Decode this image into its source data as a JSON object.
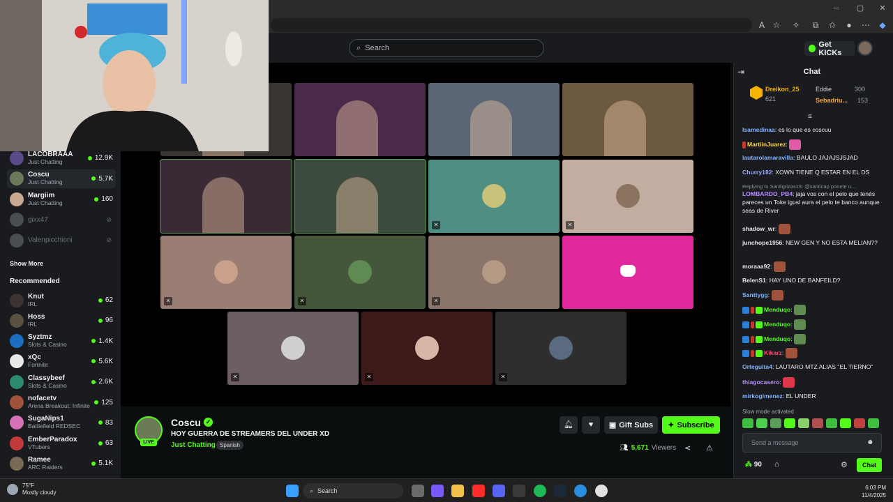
{
  "search": {
    "placeholder": "Search"
  },
  "header": {
    "get_kicks": "Get KICKs"
  },
  "sidebar": {
    "following": [
      {
        "name": "LACOBRAAA",
        "category": "Just Chatting",
        "viewers": "12.9K",
        "live": true,
        "avatar": "#5a4a8a"
      },
      {
        "name": "Coscu",
        "category": "Just Chatting",
        "viewers": "5.7K",
        "live": true,
        "avatar": "#6b7a57",
        "active": true
      },
      {
        "name": "Margiim",
        "category": "Just Chatting",
        "viewers": "160",
        "live": true,
        "avatar": "#c8a890"
      },
      {
        "name": "gixx47",
        "category": "",
        "viewers": "",
        "live": false,
        "avatar": "#4a4d52"
      },
      {
        "name": "Valenpicchioni",
        "category": "",
        "viewers": "",
        "live": false,
        "avatar": "#4a4d52"
      }
    ],
    "show_more": "Show More",
    "recommended_title": "Recommended",
    "recommended": [
      {
        "name": "Knut",
        "category": "IRL",
        "viewers": "62",
        "avatar": "#3a3330"
      },
      {
        "name": "Hoss",
        "category": "IRL",
        "viewers": "96",
        "avatar": "#5a5040"
      },
      {
        "name": "Syztmz",
        "category": "Slots & Casino",
        "viewers": "1.4K",
        "avatar": "#1b6ec2"
      },
      {
        "name": "xQc",
        "category": "Fortnite",
        "viewers": "5.6K",
        "avatar": "#e8e8e8"
      },
      {
        "name": "Classybeef",
        "category": "Slots & Casino",
        "viewers": "2.6K",
        "avatar": "#2b8a6e"
      },
      {
        "name": "nofacetv",
        "category": "Arena Breakout: Infinite",
        "viewers": "125",
        "avatar": "#a0523a"
      },
      {
        "name": "SugaNips1",
        "category": "Battlefield REDSEC",
        "viewers": "83",
        "avatar": "#d472b5"
      },
      {
        "name": "EmberParadox",
        "category": "VTubers",
        "viewers": "63",
        "avatar": "#c23a3a"
      },
      {
        "name": "Ramee",
        "category": "ARC Raiders",
        "viewers": "5.1K",
        "avatar": "#7a6a55"
      }
    ]
  },
  "stream_grid": {
    "tiles": [
      {
        "kind": "video",
        "color": "#3a3530"
      },
      {
        "kind": "video",
        "color": "#4a2a4a"
      },
      {
        "kind": "video",
        "color": "#5a6675"
      },
      {
        "kind": "video",
        "color": "#6b5a40"
      },
      {
        "kind": "video",
        "color": "#3a2a35",
        "speaking": true
      },
      {
        "kind": "video",
        "color": "#3d4a3e",
        "speaking": true
      },
      {
        "kind": "avatar",
        "color": "#4f8e83",
        "circle": "#c9c27a",
        "muted": true
      },
      {
        "kind": "avatar",
        "color": "#c2ada0",
        "circle": "#8a7460",
        "muted": true
      },
      {
        "kind": "avatar",
        "color": "#9a7d73",
        "circle": "#c9a08a",
        "muted": true
      },
      {
        "kind": "avatar",
        "color": "#44573b",
        "circle": "#5f8a52",
        "muted": true
      },
      {
        "kind": "avatar",
        "color": "#8b756a",
        "circle": "#b49a85",
        "muted": true
      },
      {
        "kind": "discord",
        "color": "#e0279c"
      },
      {
        "kind": "avatar",
        "color": "#6d5e62",
        "circle": "#cfcfcf",
        "muted": true
      },
      {
        "kind": "avatar",
        "color": "#3e1a1a",
        "circle": "#d9b5a6",
        "muted": true
      },
      {
        "kind": "avatar",
        "color": "#2e2e2e",
        "circle": "#5a6a80",
        "muted": true
      }
    ]
  },
  "channel": {
    "name": "Coscu",
    "title": "HOY GUERRA DE STREAMERS DEL UNDER XD",
    "category": "Just Chatting",
    "language": "Spanish",
    "live_label": "LIVE",
    "viewers": "5,671",
    "viewers_label": "Viewers",
    "gift_subs": "Gift Subs",
    "subscribe": "Subscribe"
  },
  "chat": {
    "title": "Chat",
    "gifters": [
      {
        "name": "Dreikon_25",
        "amount": "621"
      },
      {
        "name": "Eddie",
        "amount": "300"
      },
      {
        "name": "Sebadriu...",
        "amount": "153"
      }
    ],
    "messages": [
      {
        "user": "Isamedinaa",
        "color": "#7fb3ff",
        "text": "es lo que es coscuu"
      },
      {
        "user": "MartiinJuarez",
        "color": "#ffd84a",
        "text": "",
        "emote": "#e05aa5"
      },
      {
        "user": "lautarolamaravilla",
        "color": "#7fb3ff",
        "text": "BAULO JAJAJSJSJAD"
      },
      {
        "user": "Churry182",
        "color": "#9aa8ff",
        "text": "XOWN TIENE Q ESTAR EN EL DS"
      },
      {
        "reply": "Replying to Santigrizas19: @santicap ponete u..."
      },
      {
        "user": "LOMBARDO_PB4",
        "color": "#b78cff",
        "text": "jaja vos con el pelo que tenés pareces un Toke igusl aura el pelo te banco aunque seas de River"
      },
      {
        "user": "shadow_wr",
        "color": "#e6e6e6",
        "text": "",
        "emote": "#a0523a"
      },
      {
        "user": "junchope1956",
        "color": "#e6e6e6",
        "text": "NEW GEN Y NO ESTA MELIAN??"
      },
      {
        "user": "moraaa92",
        "color": "#e6e6e6",
        "text": "",
        "emote": "#a0523a"
      },
      {
        "user": "BelenS1",
        "color": "#e6e6e6",
        "text": "HAY UNO DE BANFEILD?"
      },
      {
        "user": "Santtygg",
        "color": "#7fb3ff",
        "text": "",
        "emote": "#a0523a"
      },
      {
        "user": "Menduqo",
        "color": "#53fc18",
        "text": "",
        "emote": "#5f8a52"
      },
      {
        "user": "Menduqo",
        "color": "#53fc18",
        "text": "",
        "emote": "#5f8a52"
      },
      {
        "user": "Menduqo",
        "color": "#53fc18",
        "text": "",
        "emote": "#5f8a52"
      },
      {
        "user": "Kikarz",
        "color": "#ff4a6b",
        "text": "",
        "emote": "#a0523a"
      },
      {
        "user": "Orteguita4",
        "color": "#7fb3ff",
        "text": "LAUTARO MTZ ALIAS \"EL TIERNO\""
      },
      {
        "user": "thiagocasero",
        "color": "#b78cff",
        "text": "",
        "emote": "#e0364a"
      },
      {
        "user": "mirkogimenez",
        "color": "#7fb3ff",
        "text": "EL UNDER"
      }
    ],
    "slow_mode": "Slow mode activated",
    "input_placeholder": "Send a message",
    "points": "90",
    "send_label": "Chat"
  },
  "taskbar": {
    "temp": "75°F",
    "weather": "Mostly cloudy",
    "search": "Search",
    "time": "6:03 PM",
    "date": "11/4/2025"
  }
}
